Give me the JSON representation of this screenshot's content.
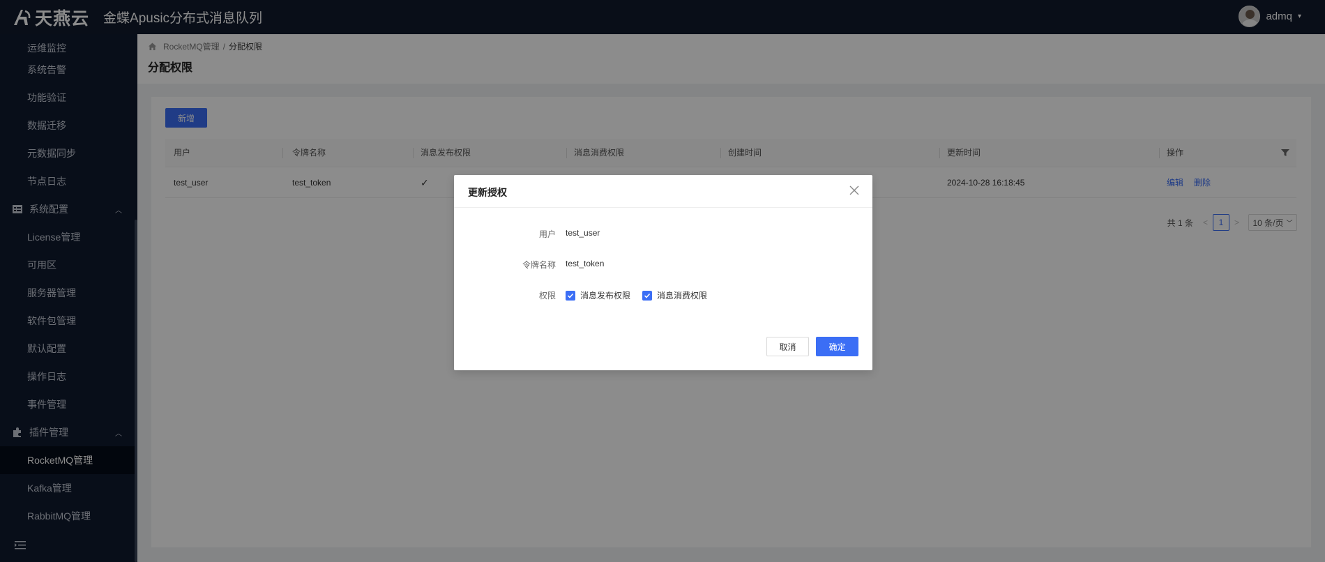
{
  "topbar": {
    "logo_text": "天燕云",
    "app_title": "金蝶Apusic分布式消息队列",
    "username": "admq"
  },
  "sidebar": {
    "items": [
      {
        "label": "运维监控"
      },
      {
        "label": "系统告警"
      },
      {
        "label": "功能验证"
      },
      {
        "label": "数据迁移"
      },
      {
        "label": "元数据同步"
      },
      {
        "label": "节点日志"
      }
    ],
    "group_config": {
      "label": "系统配置"
    },
    "config_items": [
      {
        "label": "License管理"
      },
      {
        "label": "可用区"
      },
      {
        "label": "服务器管理"
      },
      {
        "label": "软件包管理"
      },
      {
        "label": "默认配置"
      },
      {
        "label": "操作日志"
      },
      {
        "label": "事件管理"
      }
    ],
    "group_plugin": {
      "label": "插件管理"
    },
    "plugin_items": [
      {
        "label": "RocketMQ管理",
        "active": true
      },
      {
        "label": "Kafka管理"
      },
      {
        "label": "RabbitMQ管理"
      }
    ]
  },
  "breadcrumb": {
    "parent": "RocketMQ管理",
    "separator": "/",
    "current": "分配权限"
  },
  "page_title": "分配权限",
  "toolbar": {
    "add_label": "新增"
  },
  "table": {
    "columns": [
      "用户",
      "令牌名称",
      "消息发布权限",
      "消息消费权限",
      "创建时间",
      "更新时间",
      "操作"
    ],
    "rows": [
      {
        "user": "test_user",
        "token": "test_token",
        "publish": "✓",
        "updated": "2024-10-28 16:18:45",
        "edit": "编辑",
        "delete": "删除"
      }
    ]
  },
  "pagination": {
    "total": "共 1 条",
    "current": "1",
    "page_size": "10 条/页"
  },
  "modal": {
    "title": "更新授权",
    "user_label": "用户",
    "user_value": "test_user",
    "token_label": "令牌名称",
    "token_value": "test_token",
    "perm_label": "权限",
    "perm_publish": "消息发布权限",
    "perm_consume": "消息消费权限",
    "perm_publish_checked": true,
    "perm_consume_checked": true,
    "cancel_label": "取消",
    "ok_label": "确定"
  },
  "colors": {
    "primary": "#3b6ef5",
    "nav_bg": "#0f1a2e",
    "topbar_bg": "#111a2c"
  }
}
